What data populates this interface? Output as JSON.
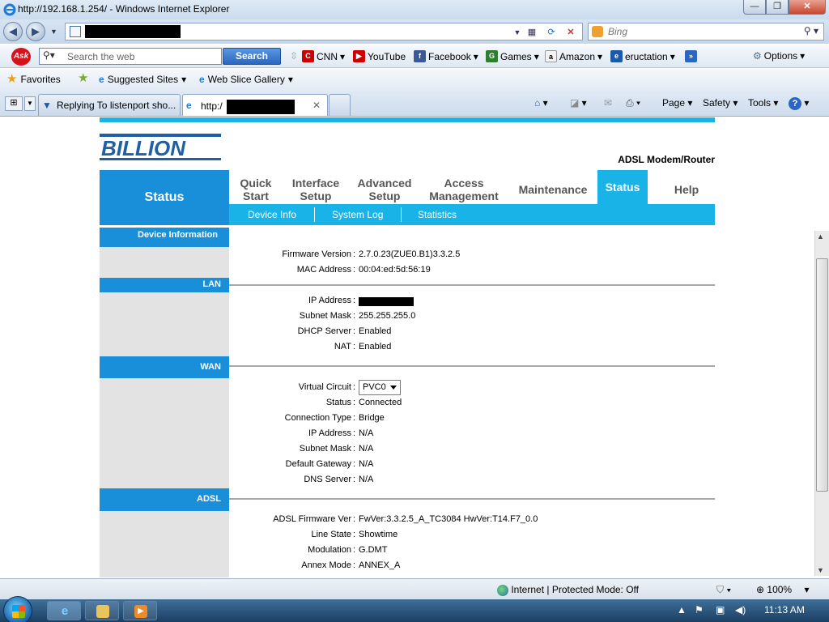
{
  "window": {
    "title": "http://192.168.1.254/ - Windows Internet Explorer",
    "minimize": "—",
    "restore": "❐",
    "close": "✕"
  },
  "addressbar": {
    "search_placeholder": "Bing"
  },
  "askbar": {
    "logo": "Ask",
    "search_placeholder": "Search the web",
    "search_button": "Search",
    "links": [
      {
        "label": "CNN",
        "icon": "cnn-icon",
        "color": "#cc0000"
      },
      {
        "label": "YouTube",
        "icon": "youtube-icon",
        "color": "#cc0000"
      },
      {
        "label": "Facebook",
        "icon": "facebook-icon",
        "color": "#3b5998"
      },
      {
        "label": "Games",
        "icon": "games-icon",
        "color": "#2e7d32"
      },
      {
        "label": "Amazon",
        "icon": "amazon-icon",
        "color": "#222222"
      },
      {
        "label": "eructation",
        "icon": "eructation-icon",
        "color": "#1c5aa8"
      }
    ],
    "more": "»",
    "options": "Options"
  },
  "favorites": {
    "favorites_label": "Favorites",
    "suggested_sites": "Suggested Sites",
    "web_slice_gallery": "Web Slice Gallery"
  },
  "tabs": [
    {
      "label": "Replying To listenport sho..."
    },
    {
      "label": "http:/"
    }
  ],
  "commands": {
    "page": "Page",
    "safety": "Safety",
    "tools": "Tools",
    "help": "?"
  },
  "router": {
    "brand": "BILLION",
    "product": "ADSL Modem/Router",
    "section_title": "Status",
    "menu": [
      {
        "line1": "Quick",
        "line2": "Start"
      },
      {
        "line1": "Interface",
        "line2": "Setup"
      },
      {
        "line1": "Advanced",
        "line2": "Setup"
      },
      {
        "line1": "Access",
        "line2": "Management"
      },
      {
        "line1": "Maintenance",
        "line2": ""
      },
      {
        "line1": "Status",
        "line2": ""
      },
      {
        "line1": "Help",
        "line2": ""
      }
    ],
    "submenu": [
      "Device Info",
      "System Log",
      "Statistics"
    ],
    "sections": {
      "device_info": "Device Information",
      "lan": "LAN",
      "wan": "WAN",
      "adsl": "ADSL"
    },
    "device": {
      "firmware_label": "Firmware Version",
      "firmware_value": "2.7.0.23(ZUE0.B1)3.3.2.5",
      "mac_label": "MAC Address",
      "mac_value": "00:04:ed:5d:56:19"
    },
    "lan": {
      "ip_label": "IP Address",
      "subnet_label": "Subnet Mask",
      "subnet_value": "255.255.255.0",
      "dhcp_label": "DHCP Server",
      "dhcp_value": "Enabled",
      "nat_label": "NAT",
      "nat_value": "Enabled"
    },
    "wan": {
      "vc_label": "Virtual Circuit",
      "vc_value": "PVC0",
      "status_label": "Status",
      "status_value": "Connected",
      "conn_type_label": "Connection Type",
      "conn_type_value": "Bridge",
      "ip_label": "IP Address",
      "ip_value": "N/A",
      "subnet_label": "Subnet Mask",
      "subnet_value": "N/A",
      "gateway_label": "Default Gateway",
      "gateway_value": "N/A",
      "dns_label": "DNS Server",
      "dns_value": "N/A"
    },
    "adsl": {
      "fw_label": "ADSL Firmware Ver",
      "fw_value": "FwVer:3.3.2.5_A_TC3084 HwVer:T14.F7_0.0",
      "line_label": "Line State",
      "line_value": "Showtime",
      "mod_label": "Modulation",
      "mod_value": "G.DMT",
      "annex_label": "Annex Mode",
      "annex_value": "ANNEX_A"
    }
  },
  "statusbar": {
    "zone": "Internet | Protected Mode: Off",
    "zoom": "100%"
  },
  "taskbar": {
    "time": "11:13 AM"
  }
}
